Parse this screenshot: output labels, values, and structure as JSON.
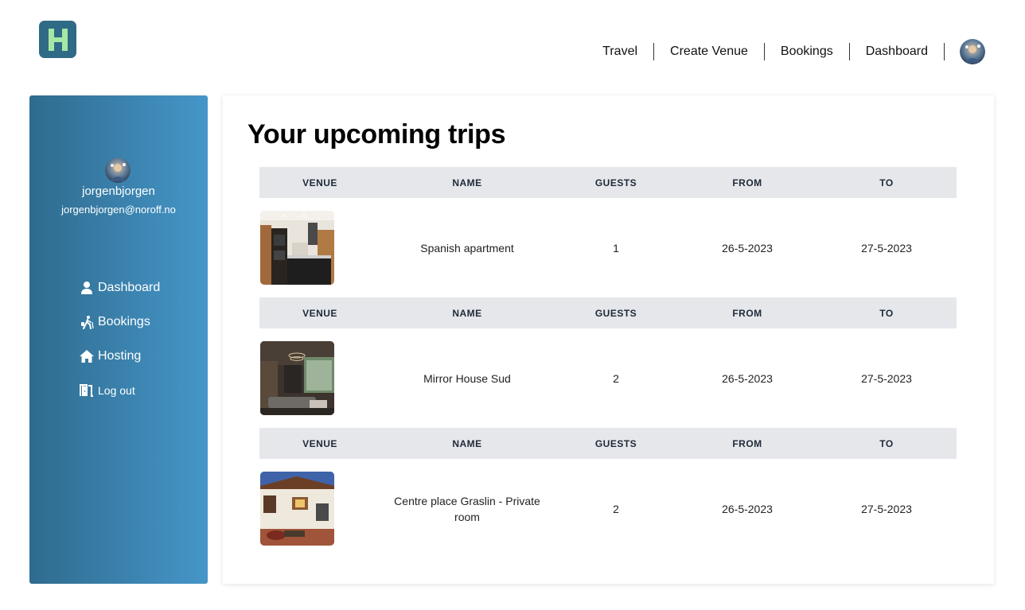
{
  "header": {
    "logo_icon": "h-logo-icon",
    "logo_color": "#2f6a86",
    "nav": [
      {
        "label": "Travel"
      },
      {
        "label": "Create Venue"
      },
      {
        "label": "Bookings"
      },
      {
        "label": "Dashboard"
      }
    ],
    "avatar_icon": "user-avatar-icon"
  },
  "sidebar": {
    "gradient": [
      "#2f6b8e",
      "#4596c9"
    ],
    "username": "jorgenbjorgen",
    "email": "jorgenbjorgen@noroff.no",
    "items": [
      {
        "label": "Dashboard",
        "icon": "user-icon"
      },
      {
        "label": "Bookings",
        "icon": "hiking-icon"
      },
      {
        "label": "Hosting",
        "icon": "home-icon"
      },
      {
        "label": "Log out",
        "icon": "door-exit-icon"
      }
    ]
  },
  "main": {
    "title": "Your upcoming trips",
    "columns": [
      "VENUE",
      "NAME",
      "GUESTS",
      "FROM",
      "TO"
    ],
    "trips": [
      {
        "name": "Spanish apartment",
        "guests": "1",
        "from": "26-5-2023",
        "to": "27-5-2023",
        "image": "kitchen-photo"
      },
      {
        "name": "Mirror House Sud",
        "guests": "2",
        "from": "26-5-2023",
        "to": "27-5-2023",
        "image": "living-room-photo"
      },
      {
        "name": "Centre place Graslin - Private room",
        "guests": "2",
        "from": "26-5-2023",
        "to": "27-5-2023",
        "image": "courtyard-photo"
      }
    ]
  }
}
